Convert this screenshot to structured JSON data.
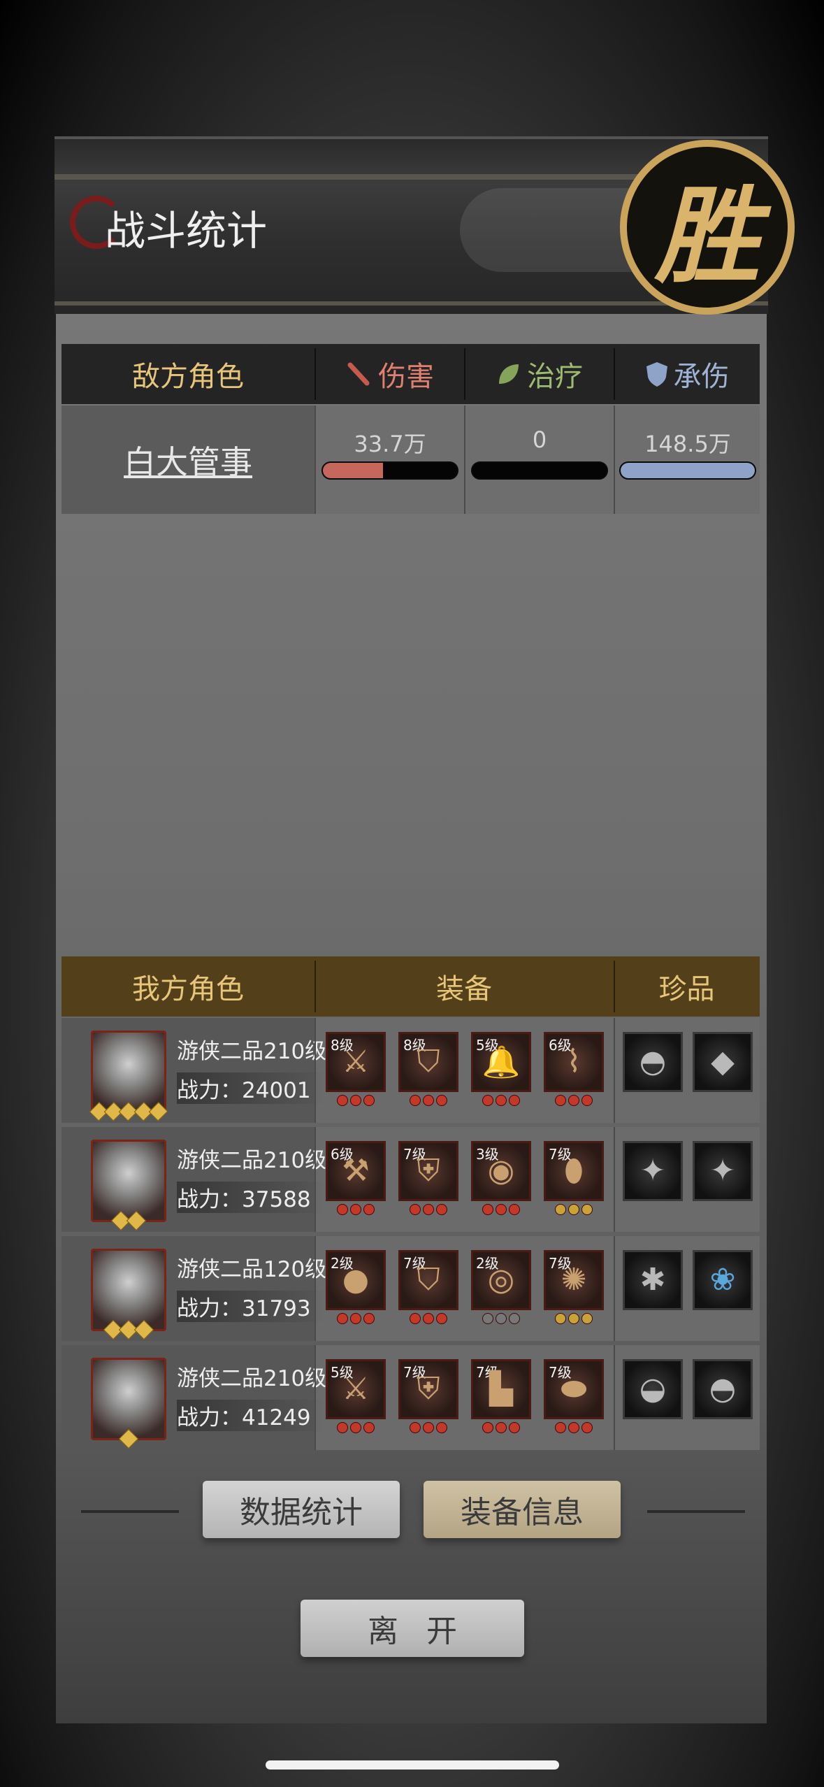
{
  "header": {
    "title": "战斗统计",
    "victory_badge": "胜"
  },
  "enemy_table": {
    "columns": {
      "role": "敌方角色",
      "damage": "伤害",
      "healing": "治疗",
      "taken": "承伤"
    },
    "column_icons": [
      "sword-icon",
      "leaf-icon",
      "shield-icon"
    ],
    "rows": [
      {
        "name": "白大管事",
        "damage": "33.7万",
        "healing": "0",
        "taken": "148.5万",
        "damage_fill": 0.45,
        "healing_fill": 0,
        "taken_fill": 1.0
      }
    ]
  },
  "ally_table": {
    "columns": {
      "role": "我方角色",
      "equipment": "装备",
      "treasures": "珍品"
    },
    "rows": [
      {
        "class_level": "游侠二品210级",
        "power": "战力：24001",
        "stars": 5,
        "equipment": [
          {
            "level": "8级",
            "icon": "crossbow-icon"
          },
          {
            "level": "8级",
            "icon": "cloak-icon"
          },
          {
            "level": "5级",
            "icon": "bell-icon"
          },
          {
            "level": "6级",
            "icon": "bracer-icon"
          }
        ],
        "treasures": [
          "comb-icon",
          "jade-icon"
        ]
      },
      {
        "class_level": "游侠二品210级",
        "power": "战力：37588",
        "stars": 2,
        "equipment": [
          {
            "level": "6级",
            "icon": "mace-icon"
          },
          {
            "level": "7级",
            "icon": "armor-icon"
          },
          {
            "level": "3级",
            "icon": "drum-icon"
          },
          {
            "level": "7级",
            "icon": "jade-pendant-icon"
          }
        ],
        "treasures": [
          "hairpin-icon",
          "hairpin-icon"
        ]
      },
      {
        "class_level": "游侠二品120级",
        "power": "战力：31793",
        "stars": 3,
        "equipment": [
          {
            "level": "2级",
            "icon": "gourd-icon"
          },
          {
            "level": "7级",
            "icon": "robe-icon"
          },
          {
            "level": "2级",
            "icon": "jade-disc-icon"
          },
          {
            "level": "7级",
            "icon": "red-bead-icon"
          }
        ],
        "treasures": [
          "scorpion-icon",
          "lotus-icon"
        ]
      },
      {
        "class_level": "游侠二品210级",
        "power": "战力：41249",
        "stars": 1,
        "equipment": [
          {
            "level": "5级",
            "icon": "sword-icon"
          },
          {
            "level": "7级",
            "icon": "armor-icon"
          },
          {
            "level": "7级",
            "icon": "boots-icon"
          },
          {
            "level": "7级",
            "icon": "pouch-icon"
          }
        ],
        "treasures": [
          "stone-fish-icon",
          "comb-icon"
        ]
      }
    ]
  },
  "buttons": {
    "stats": "数据统计",
    "equipment_info": "装备信息",
    "leave": "离开"
  },
  "colors": {
    "damage_bar": "#c6675e",
    "taken_bar": "#8fa3c9",
    "gold_text": "#e7c57a",
    "heal_text": "#9dbb73",
    "shield_text": "#9fb3d6"
  }
}
